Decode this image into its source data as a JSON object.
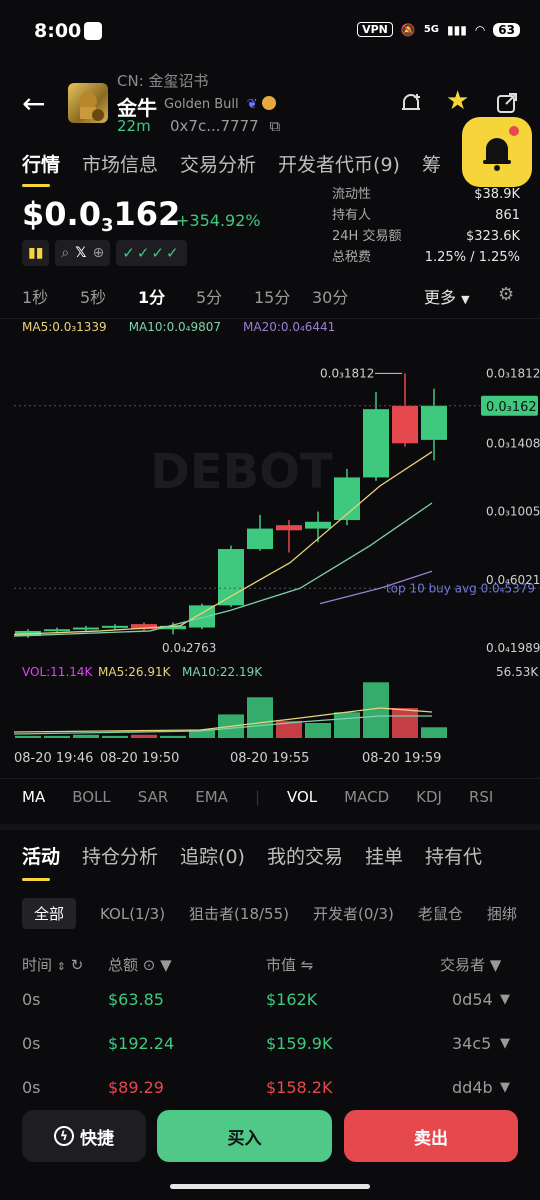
{
  "status_bar": {
    "time": "8:00",
    "vpn": "VPN",
    "net": "5G",
    "battery": "63"
  },
  "token": {
    "cn_label": "CN: 金玺诏书",
    "name": "金牛",
    "sub_name": "Golden Bull",
    "age": "22m",
    "address": "0x7c...7777"
  },
  "main_tabs": [
    "行情",
    "市场信息",
    "交易分析",
    "开发者代币(9)",
    "筹"
  ],
  "price": {
    "prefix": "$0.0",
    "sub": "3",
    "rest": "162",
    "change": "+354.92%"
  },
  "stats": [
    {
      "label": "流动性",
      "value": "$38.9K"
    },
    {
      "label": "持有人",
      "value": "861"
    },
    {
      "label": "24H 交易额",
      "value": "$323.6K"
    },
    {
      "label": "总税费",
      "value": "1.25% / 1.25%"
    }
  ],
  "intervals": [
    "1秒",
    "5秒",
    "1分",
    "5分",
    "15分",
    "30分"
  ],
  "intervals_active": "1分",
  "more_label": "更多",
  "ma_legend": [
    {
      "label": "MA5:0.0₃1339",
      "color": "#e8d27a"
    },
    {
      "label": "MA10:0.0₄9807",
      "color": "#7fd1a8"
    },
    {
      "label": "MA20:0.0₄6441",
      "color": "#9a7fd6"
    }
  ],
  "chart_data": {
    "type": "candlestick",
    "watermark": "DEBOT",
    "y_ticks": [
      "0.0₃1812",
      "0.0₃1408",
      "0.0₃1005",
      "0.0₄6021",
      "0.0₄1989"
    ],
    "current_price_label": "0.0₃162",
    "high_label": "0.0₃1812",
    "low_label": "0.0₄2763",
    "buy_avg_label": "top 10 buy avg 0.0₄5379",
    "x_ticks": [
      "08-20 19:46",
      "08-20 19:50",
      "08-20 19:55",
      "08-20 19:59"
    ],
    "candles": [
      {
        "o": 0.27,
        "c": 0.3,
        "h": 0.31,
        "l": 0.26
      },
      {
        "o": 0.3,
        "c": 0.31,
        "h": 0.32,
        "l": 0.29
      },
      {
        "o": 0.31,
        "c": 0.32,
        "h": 0.33,
        "l": 0.3
      },
      {
        "o": 0.32,
        "c": 0.33,
        "h": 0.34,
        "l": 0.31
      },
      {
        "o": 0.34,
        "c": 0.31,
        "h": 0.35,
        "l": 0.3
      },
      {
        "o": 0.31,
        "c": 0.33,
        "h": 0.35,
        "l": 0.28
      },
      {
        "o": 0.32,
        "c": 0.45,
        "h": 0.46,
        "l": 0.31
      },
      {
        "o": 0.45,
        "c": 0.78,
        "h": 0.8,
        "l": 0.44
      },
      {
        "o": 0.78,
        "c": 0.9,
        "h": 0.98,
        "l": 0.77
      },
      {
        "o": 0.92,
        "c": 0.89,
        "h": 0.95,
        "l": 0.76
      },
      {
        "o": 0.9,
        "c": 0.94,
        "h": 1.0,
        "l": 0.82
      },
      {
        "o": 0.95,
        "c": 1.2,
        "h": 1.25,
        "l": 0.92
      },
      {
        "o": 1.2,
        "c": 1.6,
        "h": 1.7,
        "l": 1.18
      },
      {
        "o": 1.62,
        "c": 1.4,
        "h": 1.81,
        "l": 1.38
      },
      {
        "o": 1.42,
        "c": 1.62,
        "h": 1.72,
        "l": 1.3
      }
    ],
    "volume": {
      "legend": [
        {
          "label": "VOL:11.14K",
          "color": "#e040fb"
        },
        {
          "label": "MA5:26.91K",
          "color": "#e8d27a"
        },
        {
          "label": "MA10:22.19K",
          "color": "#7fd1a8"
        }
      ],
      "max_label": "56.53K",
      "values": [
        2,
        2,
        3,
        2,
        3,
        2,
        8,
        22,
        38,
        16,
        14,
        24,
        52,
        28,
        10
      ]
    }
  },
  "indicator_tabs": [
    "MA",
    "BOLL",
    "SAR",
    "EMA",
    "VOL",
    "MACD",
    "KDJ",
    "RSI"
  ],
  "activity_tabs": [
    "活动",
    "持仓分析",
    "追踪(0)",
    "我的交易",
    "挂单",
    "持有代"
  ],
  "filters": [
    "全部",
    "KOL(1/3)",
    "狙击者(18/55)",
    "开发者(0/3)",
    "老鼠仓",
    "捆绑"
  ],
  "table": {
    "headers": {
      "time": "时间",
      "total": "总额",
      "mcap": "市值",
      "trader": "交易者"
    },
    "rows": [
      {
        "time": "0s",
        "total": "$63.85",
        "mcap": "$162K",
        "trader": "0d54",
        "side": "buy"
      },
      {
        "time": "0s",
        "total": "$192.24",
        "mcap": "$159.9K",
        "trader": "34c5",
        "side": "buy"
      },
      {
        "time": "0s",
        "total": "$89.29",
        "mcap": "$158.2K",
        "trader": "dd4b",
        "side": "sell"
      }
    ]
  },
  "bottom": {
    "quick": "快捷",
    "buy": "买入",
    "sell": "卖出"
  },
  "colors": {
    "up": "#3ec97e",
    "down": "#e5484d",
    "accent": "#f5d53a"
  }
}
